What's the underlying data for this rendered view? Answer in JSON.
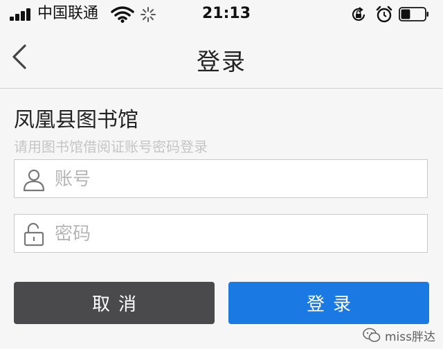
{
  "status_bar": {
    "carrier": "中国联通",
    "time": "21:13",
    "icons": [
      "signal-icon",
      "wifi-icon",
      "activity-spinner-icon",
      "rotation-lock-icon",
      "alarm-icon",
      "battery-icon"
    ],
    "battery_level": 0.15
  },
  "nav": {
    "back_icon": "chevron-left-icon",
    "title": "登录"
  },
  "form": {
    "library_name": "凤凰县图书馆",
    "hint": "请用图书馆借阅证账号密码登录",
    "account": {
      "placeholder": "账号",
      "value": "",
      "icon": "user-icon"
    },
    "password": {
      "placeholder": "密码",
      "value": "",
      "icon": "unlock-icon"
    }
  },
  "buttons": {
    "cancel_label": "取消",
    "login_label": "登录",
    "cancel_color": "#4a4a4c",
    "login_color": "#1a79e3"
  },
  "watermark": {
    "text": "miss胖达",
    "icon": "wechat-icon"
  }
}
